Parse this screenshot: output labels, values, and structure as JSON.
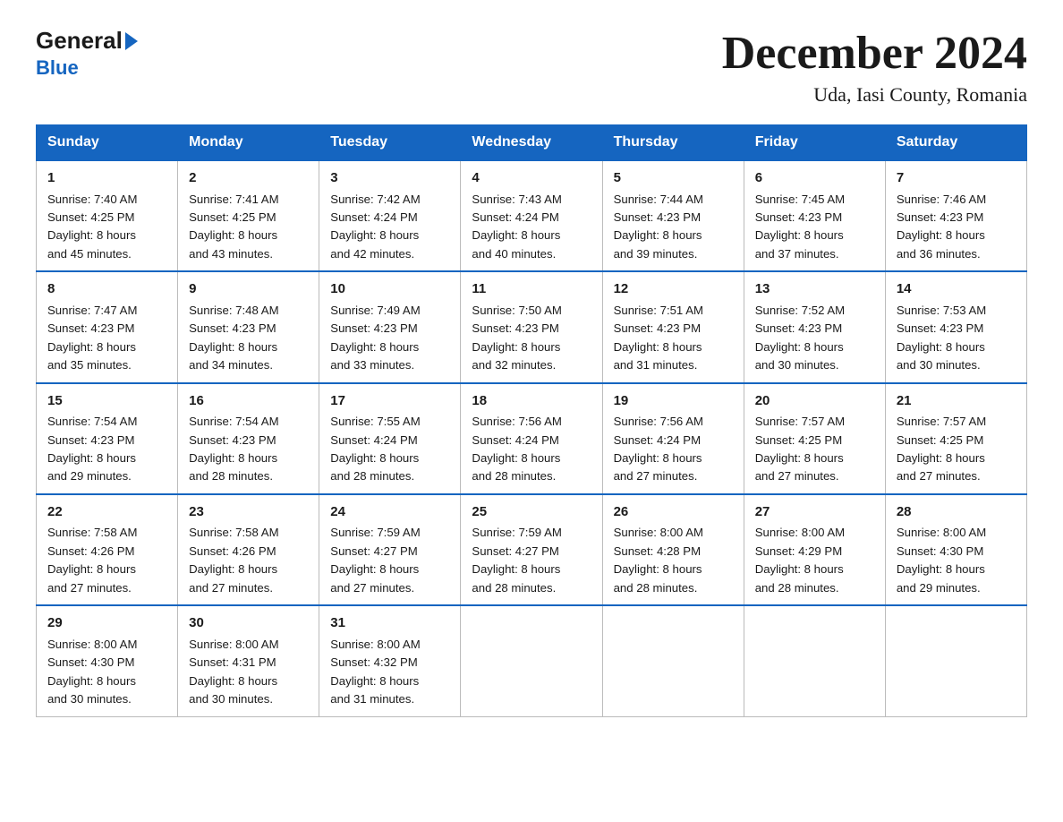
{
  "header": {
    "logo_general": "General",
    "logo_blue": "Blue",
    "title": "December 2024",
    "subtitle": "Uda, Iasi County, Romania"
  },
  "days_of_week": [
    "Sunday",
    "Monday",
    "Tuesday",
    "Wednesday",
    "Thursday",
    "Friday",
    "Saturday"
  ],
  "weeks": [
    [
      {
        "day": "1",
        "sunrise": "7:40 AM",
        "sunset": "4:25 PM",
        "daylight": "8 hours and 45 minutes."
      },
      {
        "day": "2",
        "sunrise": "7:41 AM",
        "sunset": "4:25 PM",
        "daylight": "8 hours and 43 minutes."
      },
      {
        "day": "3",
        "sunrise": "7:42 AM",
        "sunset": "4:24 PM",
        "daylight": "8 hours and 42 minutes."
      },
      {
        "day": "4",
        "sunrise": "7:43 AM",
        "sunset": "4:24 PM",
        "daylight": "8 hours and 40 minutes."
      },
      {
        "day": "5",
        "sunrise": "7:44 AM",
        "sunset": "4:23 PM",
        "daylight": "8 hours and 39 minutes."
      },
      {
        "day": "6",
        "sunrise": "7:45 AM",
        "sunset": "4:23 PM",
        "daylight": "8 hours and 37 minutes."
      },
      {
        "day": "7",
        "sunrise": "7:46 AM",
        "sunset": "4:23 PM",
        "daylight": "8 hours and 36 minutes."
      }
    ],
    [
      {
        "day": "8",
        "sunrise": "7:47 AM",
        "sunset": "4:23 PM",
        "daylight": "8 hours and 35 minutes."
      },
      {
        "day": "9",
        "sunrise": "7:48 AM",
        "sunset": "4:23 PM",
        "daylight": "8 hours and 34 minutes."
      },
      {
        "day": "10",
        "sunrise": "7:49 AM",
        "sunset": "4:23 PM",
        "daylight": "8 hours and 33 minutes."
      },
      {
        "day": "11",
        "sunrise": "7:50 AM",
        "sunset": "4:23 PM",
        "daylight": "8 hours and 32 minutes."
      },
      {
        "day": "12",
        "sunrise": "7:51 AM",
        "sunset": "4:23 PM",
        "daylight": "8 hours and 31 minutes."
      },
      {
        "day": "13",
        "sunrise": "7:52 AM",
        "sunset": "4:23 PM",
        "daylight": "8 hours and 30 minutes."
      },
      {
        "day": "14",
        "sunrise": "7:53 AM",
        "sunset": "4:23 PM",
        "daylight": "8 hours and 30 minutes."
      }
    ],
    [
      {
        "day": "15",
        "sunrise": "7:54 AM",
        "sunset": "4:23 PM",
        "daylight": "8 hours and 29 minutes."
      },
      {
        "day": "16",
        "sunrise": "7:54 AM",
        "sunset": "4:23 PM",
        "daylight": "8 hours and 28 minutes."
      },
      {
        "day": "17",
        "sunrise": "7:55 AM",
        "sunset": "4:24 PM",
        "daylight": "8 hours and 28 minutes."
      },
      {
        "day": "18",
        "sunrise": "7:56 AM",
        "sunset": "4:24 PM",
        "daylight": "8 hours and 28 minutes."
      },
      {
        "day": "19",
        "sunrise": "7:56 AM",
        "sunset": "4:24 PM",
        "daylight": "8 hours and 27 minutes."
      },
      {
        "day": "20",
        "sunrise": "7:57 AM",
        "sunset": "4:25 PM",
        "daylight": "8 hours and 27 minutes."
      },
      {
        "day": "21",
        "sunrise": "7:57 AM",
        "sunset": "4:25 PM",
        "daylight": "8 hours and 27 minutes."
      }
    ],
    [
      {
        "day": "22",
        "sunrise": "7:58 AM",
        "sunset": "4:26 PM",
        "daylight": "8 hours and 27 minutes."
      },
      {
        "day": "23",
        "sunrise": "7:58 AM",
        "sunset": "4:26 PM",
        "daylight": "8 hours and 27 minutes."
      },
      {
        "day": "24",
        "sunrise": "7:59 AM",
        "sunset": "4:27 PM",
        "daylight": "8 hours and 27 minutes."
      },
      {
        "day": "25",
        "sunrise": "7:59 AM",
        "sunset": "4:27 PM",
        "daylight": "8 hours and 28 minutes."
      },
      {
        "day": "26",
        "sunrise": "8:00 AM",
        "sunset": "4:28 PM",
        "daylight": "8 hours and 28 minutes."
      },
      {
        "day": "27",
        "sunrise": "8:00 AM",
        "sunset": "4:29 PM",
        "daylight": "8 hours and 28 minutes."
      },
      {
        "day": "28",
        "sunrise": "8:00 AM",
        "sunset": "4:30 PM",
        "daylight": "8 hours and 29 minutes."
      }
    ],
    [
      {
        "day": "29",
        "sunrise": "8:00 AM",
        "sunset": "4:30 PM",
        "daylight": "8 hours and 30 minutes."
      },
      {
        "day": "30",
        "sunrise": "8:00 AM",
        "sunset": "4:31 PM",
        "daylight": "8 hours and 30 minutes."
      },
      {
        "day": "31",
        "sunrise": "8:00 AM",
        "sunset": "4:32 PM",
        "daylight": "8 hours and 31 minutes."
      },
      null,
      null,
      null,
      null
    ]
  ],
  "labels": {
    "sunrise": "Sunrise:",
    "sunset": "Sunset:",
    "daylight": "Daylight:"
  }
}
